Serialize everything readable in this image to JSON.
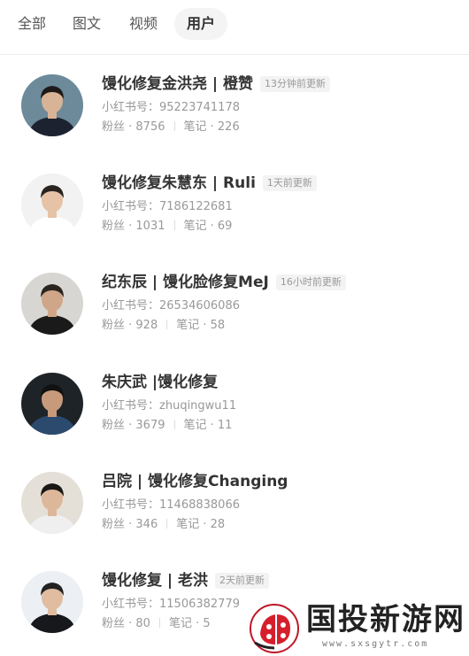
{
  "tabs": [
    {
      "label": "全部"
    },
    {
      "label": "图文"
    },
    {
      "label": "视频"
    },
    {
      "label": "用户",
      "active": true
    }
  ],
  "id_prefix": "小红书号：",
  "stat_labels": {
    "fans": "粉丝 · ",
    "notes": "笔记 · "
  },
  "users": [
    {
      "name": "馒化修复金洪尧 | 橙赞",
      "badge": "13分钟前更新",
      "id": "95223741178",
      "fans": "8756",
      "notes": "226",
      "avatar_colors": {
        "bg": "#6c8a9a",
        "hair": "#1d1a18",
        "skin": "#d9b396",
        "cloth": "#1c2230"
      }
    },
    {
      "name": "馒化修复朱慧东 | Ruli",
      "badge": "1天前更新",
      "id": "7186122681",
      "fans": "1031",
      "notes": "69",
      "avatar_colors": {
        "bg": "#f2f2f2",
        "hair": "#2a2420",
        "skin": "#e6c2a6",
        "cloth": "#ffffff"
      }
    },
    {
      "name": "纪东辰 | 馒化脸修复MeJ",
      "badge": "16小时前更新",
      "id": "26534606086",
      "fans": "928",
      "notes": "58",
      "avatar_colors": {
        "bg": "#d8d6d2",
        "hair": "#2b2520",
        "skin": "#cfa687",
        "cloth": "#1a1a1a"
      }
    },
    {
      "name": "朱庆武 |馒化修复",
      "badge": "",
      "id": "zhuqingwu11",
      "fans": "3679",
      "notes": "11",
      "avatar_colors": {
        "bg": "#1e2328",
        "hair": "#111111",
        "skin": "#c89a7c",
        "cloth": "#2b4a6e"
      }
    },
    {
      "name": "吕院 | 馒化修复Changing",
      "badge": "",
      "id": "11468838066",
      "fans": "346",
      "notes": "28",
      "avatar_colors": {
        "bg": "#e4e0d8",
        "hair": "#1a1816",
        "skin": "#dcb79a",
        "cloth": "#efefef"
      }
    },
    {
      "name": "馒化修复 | 老洪",
      "badge": "2天前更新",
      "id": "11506382779",
      "fans": "80",
      "notes": "5",
      "avatar_colors": {
        "bg": "#eceff3",
        "hair": "#222222",
        "skin": "#e0bca0",
        "cloth": "#16181c"
      }
    }
  ],
  "watermark": {
    "text": "国投新游网",
    "url": "www.sxsgytr.com",
    "icon": "ladybug-logo-icon"
  }
}
